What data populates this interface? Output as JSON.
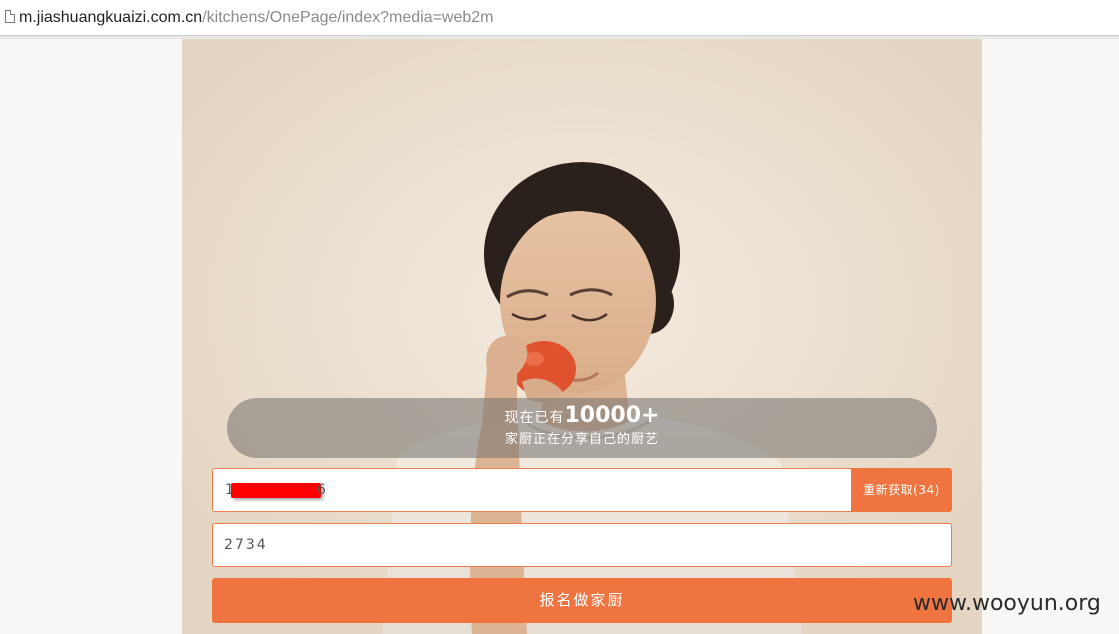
{
  "browser": {
    "url_host": "m.jiashuangkuaizi.com.cn",
    "url_path": "/kitchens/OnePage/index?media=web2m"
  },
  "hero": {
    "stats_prefix": "现在已有",
    "stats_number": "10000+",
    "stats_line2": "家厨正在分享自己的厨艺"
  },
  "form": {
    "phone_visible_start": "1",
    "phone_visible_end": "6",
    "resend_label": "重新获取(34)",
    "code_value": "2734",
    "submit_label": "报名做家厨"
  },
  "watermark": "www.wooyun.org",
  "colors": {
    "accent": "#f07440",
    "redaction": "#ff0000"
  }
}
